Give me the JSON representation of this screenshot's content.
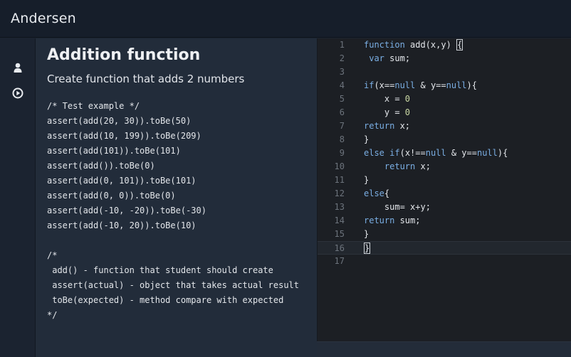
{
  "header": {
    "title": "Andersen"
  },
  "sidebar": {
    "items": [
      {
        "icon": "user-icon"
      },
      {
        "icon": "play-circle-icon"
      }
    ]
  },
  "task": {
    "title": "Addition function",
    "subtitle": "Create function that adds 2 numbers",
    "description_lines": [
      "/* Test example */",
      "assert(add(20, 30)).toBe(50)",
      "assert(add(10, 199)).toBe(209)",
      "assert(add(101)).toBe(101)",
      "assert(add()).toBe(0)",
      "assert(add(0, 101)).toBe(101)",
      "assert(add(0, 0)).toBe(0)",
      "assert(add(-10, -20)).toBe(-30)",
      "assert(add(-10, 20)).toBe(10)",
      "",
      "/*",
      " add() - function that student should create",
      " assert(actual) - object that takes actual result",
      " toBe(expected) - method compare with expected",
      "*/"
    ]
  },
  "editor": {
    "active_line": 16,
    "lines": [
      {
        "n": "1",
        "t": [
          [
            "kw",
            "function"
          ],
          [
            "tx",
            " add(x,y) "
          ],
          [
            "box",
            "{"
          ]
        ]
      },
      {
        "n": "2",
        "t": [
          [
            "tx",
            " "
          ],
          [
            "kw",
            "var"
          ],
          [
            "tx",
            " sum;"
          ]
        ]
      },
      {
        "n": "3",
        "t": []
      },
      {
        "n": "4",
        "t": [
          [
            "kw",
            "if"
          ],
          [
            "tx",
            "(x=="
          ],
          [
            "kw",
            "null"
          ],
          [
            "tx",
            " & y=="
          ],
          [
            "kw",
            "null"
          ],
          [
            "tx",
            "){"
          ]
        ]
      },
      {
        "n": "5",
        "t": [
          [
            "tx",
            "    x = "
          ],
          [
            "nu",
            "0"
          ]
        ]
      },
      {
        "n": "6",
        "t": [
          [
            "tx",
            "    y = "
          ],
          [
            "nu",
            "0"
          ]
        ]
      },
      {
        "n": "7",
        "t": [
          [
            "kw",
            "return"
          ],
          [
            "tx",
            " x;"
          ]
        ]
      },
      {
        "n": "8",
        "t": [
          [
            "tx",
            "}"
          ]
        ]
      },
      {
        "n": "9",
        "t": [
          [
            "kw",
            "else"
          ],
          [
            "tx",
            " "
          ],
          [
            "kw",
            "if"
          ],
          [
            "tx",
            "(x!=="
          ],
          [
            "kw",
            "null"
          ],
          [
            "tx",
            " & y=="
          ],
          [
            "kw",
            "null"
          ],
          [
            "tx",
            "){"
          ]
        ]
      },
      {
        "n": "10",
        "t": [
          [
            "tx",
            "    "
          ],
          [
            "kw",
            "return"
          ],
          [
            "tx",
            " x;"
          ]
        ]
      },
      {
        "n": "11",
        "t": [
          [
            "tx",
            "}"
          ]
        ]
      },
      {
        "n": "12",
        "t": [
          [
            "kw",
            "else"
          ],
          [
            "tx",
            "{"
          ]
        ]
      },
      {
        "n": "13",
        "t": [
          [
            "tx",
            "    sum= x+y;"
          ]
        ]
      },
      {
        "n": "14",
        "t": [
          [
            "kw",
            "return"
          ],
          [
            "tx",
            " sum;"
          ]
        ]
      },
      {
        "n": "15",
        "t": [
          [
            "tx",
            "}"
          ]
        ]
      },
      {
        "n": "16",
        "t": [
          [
            "box",
            "}"
          ]
        ]
      },
      {
        "n": "17",
        "t": []
      }
    ]
  },
  "colors": {
    "keyword": "#7aaee3",
    "number": "#c9d7a4",
    "text": "#e4e7eb"
  }
}
